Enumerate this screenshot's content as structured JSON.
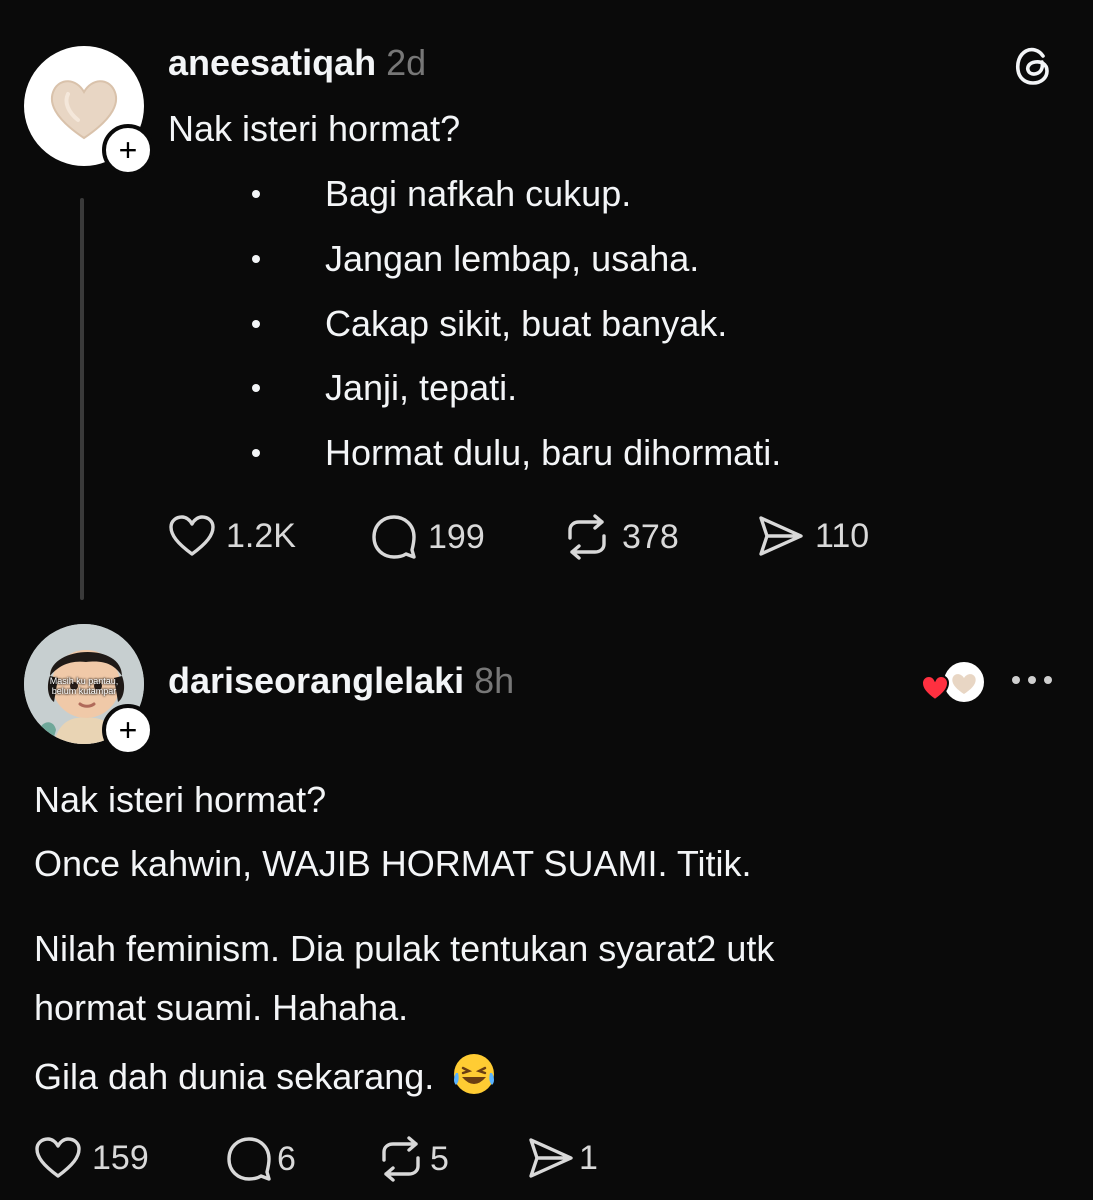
{
  "post": {
    "username": "aneesatiqah",
    "time": "2d",
    "text": "Nak isteri hormat?",
    "bullets": [
      "Bagi nafkah cukup.",
      "Jangan lembap, usaha.",
      "Cakap sikit, buat banyak.",
      "Janji, tepati.",
      "Hormat dulu, baru dihormati."
    ],
    "likes": "1.2K",
    "replies": "199",
    "reposts": "378",
    "shares": "110"
  },
  "reply": {
    "username": "dariseoranglelaki",
    "time": "8h",
    "avatar_caption_1": "Masih ku pantau,",
    "avatar_caption_2": "belum kutampar",
    "lines": [
      "Nak isteri hormat?",
      "Once kahwin, WAJIB HORMAT SUAMI. Titik.",
      "Nilah feminism. Dia pulak tentukan syarat2 utk",
      "hormat suami. Hahaha.",
      "Gila dah dunia sekarang."
    ],
    "emoji": "😂",
    "likes": "159",
    "replies": "6",
    "reposts": "5",
    "shares": "1"
  },
  "colors": {
    "background": "#0a0a0a",
    "text": "#f3f5f7",
    "muted": "#777777",
    "heart": "#ff3040"
  },
  "icons": [
    "threads-logo-icon",
    "heart-icon",
    "comment-icon",
    "repost-icon",
    "share-icon",
    "more-icon",
    "plus-icon"
  ]
}
